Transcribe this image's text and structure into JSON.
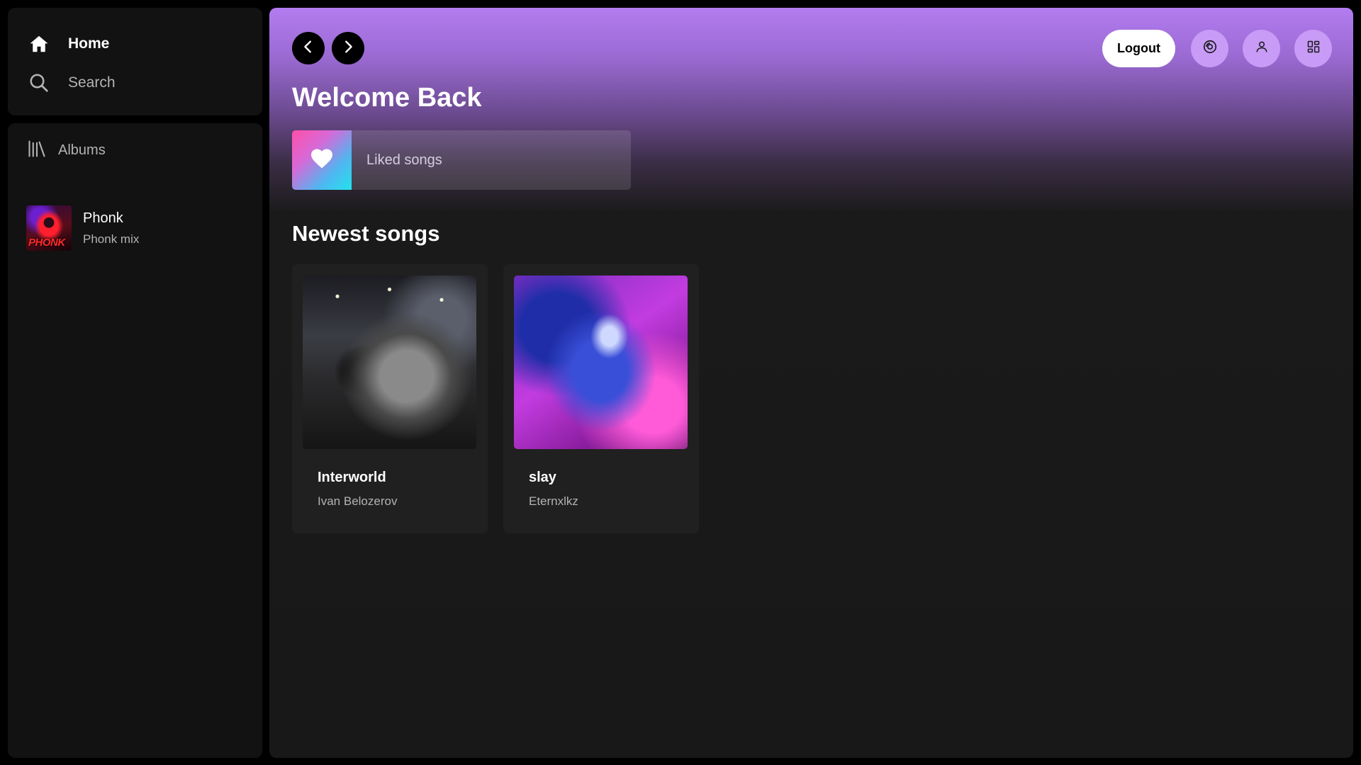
{
  "sidebar": {
    "nav": [
      {
        "label": "Home",
        "icon": "home-icon"
      },
      {
        "label": "Search",
        "icon": "search-icon"
      }
    ],
    "library": {
      "label": "Albums",
      "icon": "library-icon",
      "albums": [
        {
          "title": "Phonk",
          "subtitle": "Phonk mix",
          "art_text": "PHONK"
        }
      ]
    }
  },
  "header": {
    "back_icon": "chevron-left-icon",
    "forward_icon": "chevron-right-icon",
    "logout_label": "Logout",
    "icons": [
      "disc-icon",
      "user-icon",
      "grid-icon"
    ]
  },
  "main": {
    "title": "Welcome Back",
    "liked": {
      "label": "Liked songs",
      "icon": "heart-icon"
    },
    "newest_title": "Newest songs",
    "songs": [
      {
        "title": "Interworld",
        "artist": "Ivan Belozerov"
      },
      {
        "title": "slay",
        "artist": "Eternxlkz"
      }
    ]
  },
  "colors": {
    "accent": "#b37cf0",
    "panel": "#121212",
    "card": "#202020"
  }
}
